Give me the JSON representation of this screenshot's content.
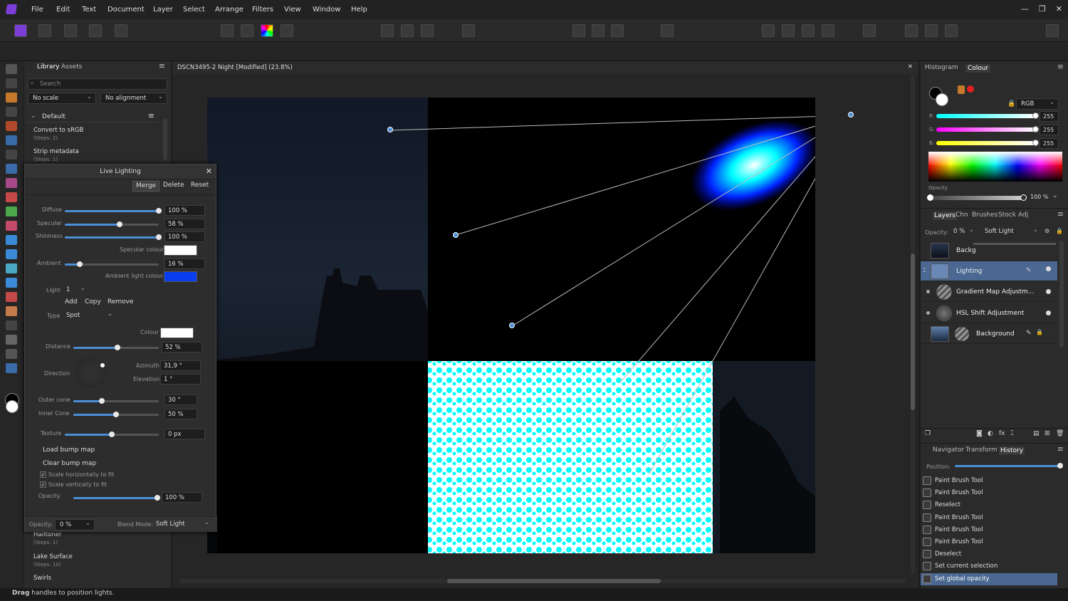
{
  "menu": [
    "File",
    "Edit",
    "Text",
    "Document",
    "Layer",
    "Select",
    "Arrange",
    "Filters",
    "View",
    "Window",
    "Help"
  ],
  "window_controls": [
    "—",
    "❐",
    "✕"
  ],
  "library": {
    "tabs": [
      "Library",
      "Assets"
    ],
    "search_placeholder": "Search",
    "scale": "No scale",
    "alignment": "No alignment",
    "category": "Default",
    "macros": [
      {
        "name": "Convert to sRGB",
        "steps": "(Steps: 2)"
      },
      {
        "name": "Strip metadata",
        "steps": "(Steps: 1)"
      },
      {
        "name": "Halftoner",
        "steps": "(Steps: 1)"
      },
      {
        "name": "Lake Surface",
        "steps": "(Steps: 10)"
      },
      {
        "name": "Swirls",
        "steps": ""
      }
    ]
  },
  "live_lighting": {
    "title": "Live Lighting",
    "buttons": {
      "merge": "Merge",
      "delete": "Delete",
      "reset": "Reset"
    },
    "diffuse": {
      "label": "Diffuse",
      "value": "100 %",
      "level": 1.0
    },
    "specular": {
      "label": "Specular",
      "value": "58 %",
      "level": 0.58
    },
    "shininess": {
      "label": "Shininess",
      "value": "100 %",
      "level": 1.0
    },
    "specular_colour": {
      "label": "Specular colour",
      "color": "#ffffff"
    },
    "ambient": {
      "label": "Ambient",
      "value": "16 %",
      "level": 0.16
    },
    "ambient_light_colour": {
      "label": "Ambient light colour",
      "color": "#0a3cf0"
    },
    "light": {
      "label": "Light",
      "value": "1"
    },
    "light_buttons": {
      "add": "Add",
      "copy": "Copy",
      "remove": "Remove"
    },
    "type": {
      "label": "Type",
      "value": "Spot"
    },
    "colour": {
      "label": "Colour",
      "color": "#ffffff"
    },
    "distance": {
      "label": "Distance",
      "value": "52 %",
      "level": 0.52
    },
    "direction": {
      "label": "Direction"
    },
    "azimuth": {
      "label": "Azimuth",
      "value": "31,9 °"
    },
    "elevation": {
      "label": "Elevation",
      "value": "1 °"
    },
    "outer_cone": {
      "label": "Outer cone",
      "value": "30 °",
      "level": 0.33
    },
    "inner_cone": {
      "label": "Inner Cone",
      "value": "50 %",
      "level": 0.5
    },
    "texture": {
      "label": "Texture",
      "value": "0 px",
      "level": 0.5
    },
    "load_bump": "Load bump map",
    "clear_bump": "Clear bump map",
    "scale_h": "Scale horizontally to fit",
    "scale_v": "Scale vertically to fit",
    "opacity": {
      "label": "Opacity",
      "value": "100 %",
      "level": 1.0
    },
    "footer_opacity_label": "Opacity:",
    "footer_opacity": "0 %",
    "blend_label": "Blend Mode:",
    "blend": "Soft Light"
  },
  "document": {
    "title": "DSCN3495-2 Night [Modified] (23.8%)"
  },
  "colour_panel": {
    "tabs": [
      "Histogram",
      "Colour"
    ],
    "model": "RGB",
    "r": {
      "label": "R:",
      "value": "255"
    },
    "g": {
      "label": "G:",
      "value": "255"
    },
    "b": {
      "label": "B:",
      "value": "255"
    },
    "opacity_label": "Opacity",
    "opacity": "100 %"
  },
  "layers_panel": {
    "tabs": [
      "Layers",
      "Chn",
      "Brushes",
      "Stock",
      "Adj"
    ],
    "opacity_label": "Opacity:",
    "opacity": "0 %",
    "blend": "Soft Light",
    "layers": [
      {
        "name": "Backg"
      },
      {
        "name": "Lighting"
      },
      {
        "name": "Gradient Map Adjustm..."
      },
      {
        "name": "HSL Shift Adjustment"
      },
      {
        "name": "Background"
      }
    ]
  },
  "history_panel": {
    "tabs": [
      "Navigator",
      "Transform",
      "History"
    ],
    "position_label": "Position:",
    "items": [
      "Paint Brush Tool",
      "Paint Brush Tool",
      "Reselect",
      "Paint Brush Tool",
      "Paint Brush Tool",
      "Paint Brush Tool",
      "Deselect",
      "Set current selection",
      "Set global opacity"
    ]
  },
  "status": {
    "bold": "Drag",
    "text": " handles to position lights."
  }
}
